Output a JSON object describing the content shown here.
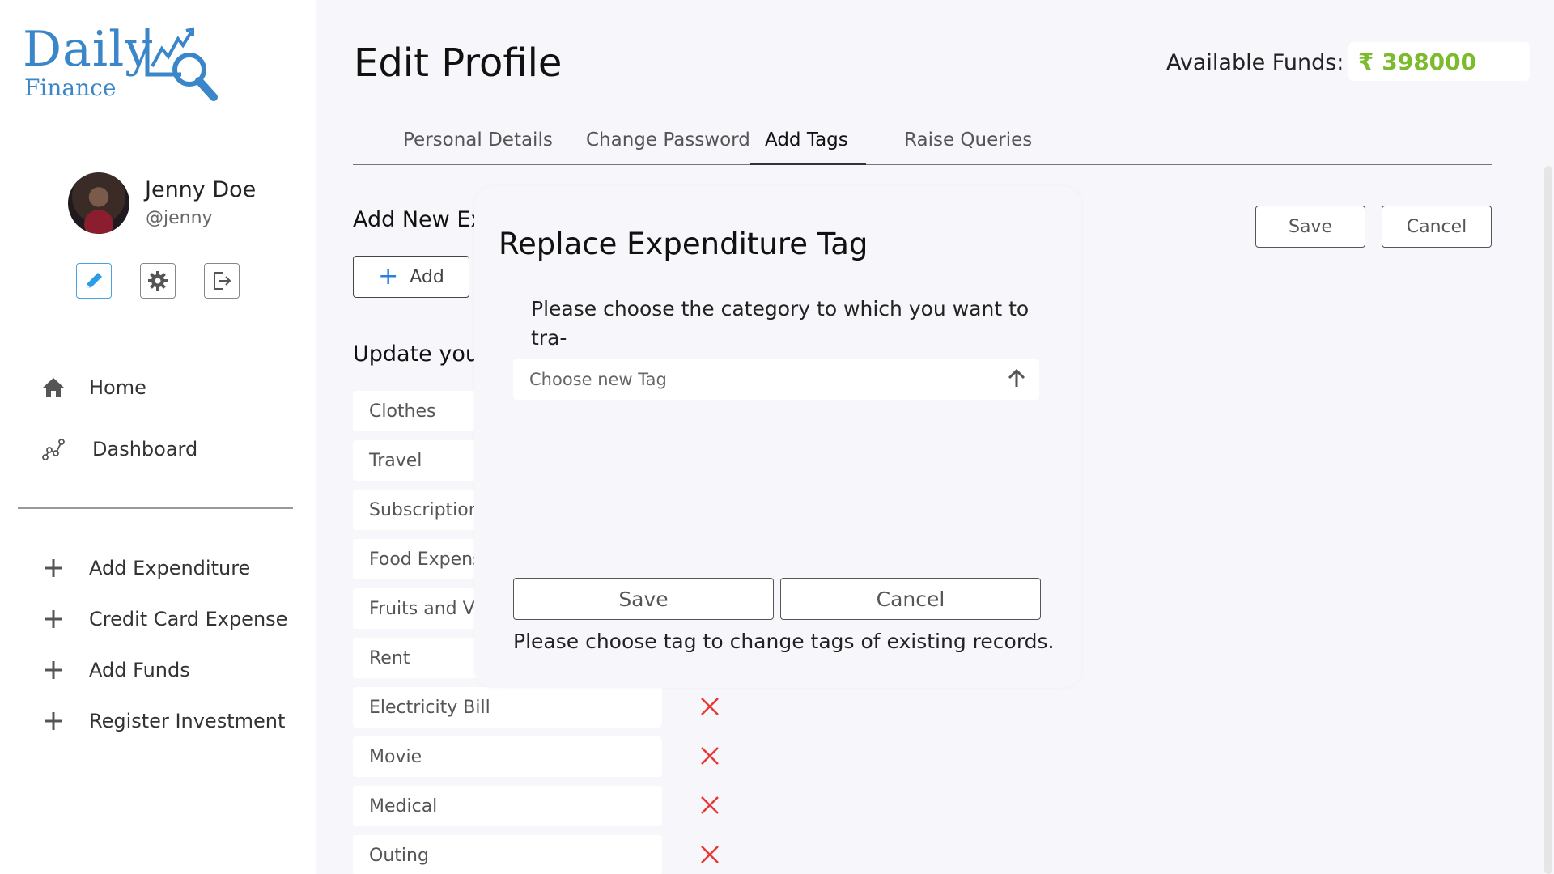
{
  "logo": {
    "line1": "Daily",
    "line2": "Finance"
  },
  "user": {
    "name": "Jenny Doe",
    "handle": "@jenny"
  },
  "nav": {
    "home": "Home",
    "dashboard": "Dashboard",
    "add_expenditure": "Add Expenditure",
    "credit_card_expense": "Credit Card Expense",
    "add_funds": "Add Funds",
    "register_investment": "Register Investment"
  },
  "header": {
    "title": "Edit Profile",
    "funds_label": "Available Funds:",
    "funds_value": "₹ 398000"
  },
  "tabs": [
    {
      "label": "Personal Details"
    },
    {
      "label": "Change Password"
    },
    {
      "label": "Add Tags"
    },
    {
      "label": "Raise Queries"
    }
  ],
  "content": {
    "add_section_title": "Add New Ex",
    "add_button": "Add",
    "update_section_title": "Update you",
    "save_button": "Save",
    "cancel_button": "Cancel",
    "tags": [
      "Clothes",
      "Travel",
      "Subscription",
      "Food Expense",
      "Fruits and Veg",
      "Rent",
      "Electricity Bill",
      "Movie",
      "Medical",
      "Outing"
    ]
  },
  "modal": {
    "title": "Replace Expenditure Tag",
    "text_line1": "Please choose the category to which you want to tra-",
    "text_line2": "-nsfer the current category's records.",
    "select_placeholder": "Choose new Tag",
    "save_button": "Save",
    "cancel_button": "Cancel",
    "note": "Please choose tag to change tags of existing records."
  },
  "colors": {
    "brand": "#3a86c8",
    "funds": "#7cbb2c",
    "delete": "#e53935",
    "accent": "#2a7de1"
  }
}
